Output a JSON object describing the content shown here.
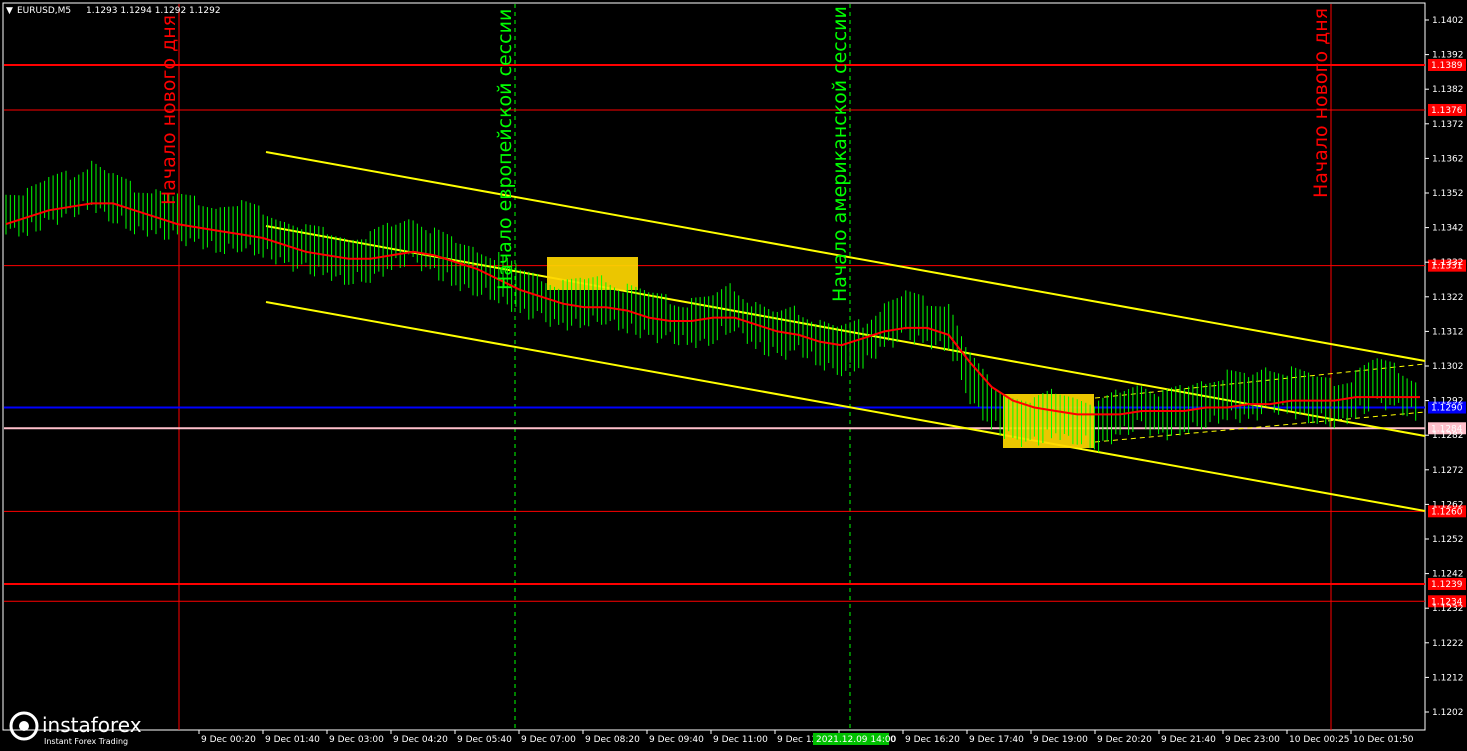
{
  "header": {
    "symbol": "EURUSD,M5",
    "ohlc": "1.1293 1.1294 1.1292 1.1292"
  },
  "annotations": {
    "day_start": "Начало нового дня",
    "eu_session": "Начало европейской сессии",
    "us_session": "Начало американской сессии"
  },
  "logo": {
    "brand": "instaforex",
    "tagline": "Instant Forex Trading"
  },
  "colors": {
    "background": "#000000",
    "candles": "#00ff00",
    "ma": "#ff0000",
    "channel": "#ffff00",
    "level_red": "#ff0000",
    "level_blue": "#0000ff",
    "level_pink": "#ffc0cb",
    "session_line": "#00ff00",
    "box": "#ffd700"
  },
  "chart_data": {
    "type": "line",
    "instrument": "EURUSD",
    "timeframe": "M5",
    "ylim": [
      1.1197,
      1.1407
    ],
    "y_ticks": [
      "1.1402",
      "1.1392",
      "1.1382",
      "1.1372",
      "1.1362",
      "1.1352",
      "1.1342",
      "1.1332",
      "1.1322",
      "1.1312",
      "1.1302",
      "1.1292",
      "1.1282",
      "1.1272",
      "1.1262",
      "1.1252",
      "1.1242",
      "1.1232",
      "1.1222",
      "1.1212",
      "1.1202"
    ],
    "x_ticks": [
      "9 Dec 00:20",
      "9 Dec 01:40",
      "9 Dec 03:00",
      "9 Dec 04:20",
      "9 Dec 05:40",
      "9 Dec 07:00",
      "9 Dec 08:20",
      "9 Dec 09:40",
      "9 Dec 11:00",
      "9 Dec 12:",
      "9 Dec 15:00",
      "9 Dec 16:20",
      "9 Dec 17:40",
      "9 Dec 19:00",
      "9 Dec 20:20",
      "9 Dec 21:40",
      "9 Dec 23:00",
      "10 Dec 00:25",
      "10 Dec 01:50"
    ],
    "highlighted_time": "2021.12.09 14:00",
    "price_levels": [
      {
        "price": 1.1389,
        "label": "1.1389",
        "color": "#ff0000"
      },
      {
        "price": 1.1376,
        "label": "1.1376",
        "color": "#ff0000"
      },
      {
        "price": 1.1331,
        "label": "1.1331",
        "color": "#ff0000"
      },
      {
        "price": 1.129,
        "label": "1.1290",
        "color": "#0000ff"
      },
      {
        "price": 1.1284,
        "label": "1.1284",
        "color": "#ffc0cb"
      },
      {
        "price": 1.126,
        "label": "1.1260",
        "color": "#ff0000"
      },
      {
        "price": 1.1239,
        "label": "1.1239",
        "color": "#ff0000"
      },
      {
        "price": 1.1234,
        "label": "1.1234",
        "color": "#ff0000"
      }
    ],
    "current_price": "1.1292",
    "price_series": [
      1.1347,
      1.1346,
      1.1349,
      1.1351,
      1.1354,
      1.135,
      1.1347,
      1.1346,
      1.1344,
      1.1343,
      1.1341,
      1.1342,
      1.134,
      1.1337,
      1.1335,
      1.1334,
      1.1332,
      1.1333,
      1.1336,
      1.1338,
      1.1334,
      1.1331,
      1.1329,
      1.1327,
      1.1323,
      1.1321,
      1.1319,
      1.132,
      1.1321,
      1.1318,
      1.1316,
      1.1315,
      1.1314,
      1.1315,
      1.1319,
      1.1313,
      1.131,
      1.1312,
      1.1308,
      1.1306,
      1.1308,
      1.1313,
      1.1316,
      1.1314,
      1.1313,
      1.1298,
      1.129,
      1.1286,
      1.1285,
      1.1288,
      1.1286,
      1.1284,
      1.1288,
      1.129,
      1.1287,
      1.1289,
      1.1291,
      1.1293,
      1.1292,
      1.1295,
      1.1294,
      1.1292,
      1.1291,
      1.1293,
      1.1297,
      1.1295,
      1.1292
    ],
    "ma_series": [
      1.1343,
      1.1345,
      1.1347,
      1.1348,
      1.1349,
      1.1349,
      1.1347,
      1.1345,
      1.1343,
      1.1342,
      1.1341,
      1.134,
      1.1339,
      1.1337,
      1.1335,
      1.1334,
      1.1333,
      1.1333,
      1.1334,
      1.1335,
      1.1334,
      1.1332,
      1.133,
      1.1327,
      1.1324,
      1.1322,
      1.132,
      1.1319,
      1.1319,
      1.1318,
      1.1316,
      1.1315,
      1.1315,
      1.1316,
      1.1316,
      1.1314,
      1.1312,
      1.1311,
      1.1309,
      1.1308,
      1.131,
      1.1312,
      1.1313,
      1.1313,
      1.1311,
      1.1303,
      1.1296,
      1.1292,
      1.129,
      1.1289,
      1.1288,
      1.1288,
      1.1288,
      1.1289,
      1.1289,
      1.1289,
      1.129,
      1.129,
      1.1291,
      1.1291,
      1.1292,
      1.1292,
      1.1292,
      1.1293,
      1.1293,
      1.1293,
      1.1293
    ]
  }
}
